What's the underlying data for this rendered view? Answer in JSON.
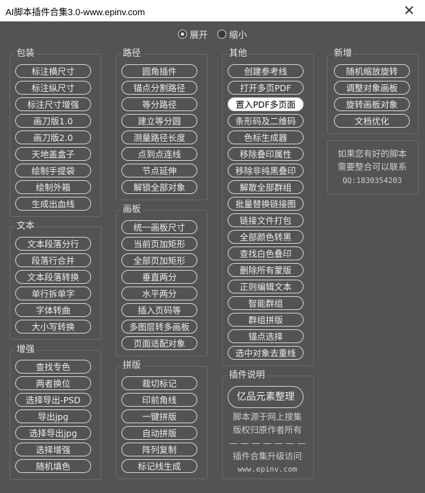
{
  "window": {
    "title": "AI脚本插件合集3.0-www.epinv.com",
    "close": "✕"
  },
  "mode": {
    "expand": "展开",
    "collapse": "缩小"
  },
  "groups": {
    "baozhuang": {
      "label": "包装",
      "items": [
        "标注横尺寸",
        "标注纵尺寸",
        "标注尺寸增强",
        "画刀版1.0",
        "画刀版2.0",
        "天地盖盒子",
        "绘制手提袋",
        "绘制外箱",
        "生成出血线"
      ]
    },
    "wenben": {
      "label": "文本",
      "items": [
        "文本段落分行",
        "段落行合并",
        "文本段落转换",
        "单行拆单字",
        "字体转曲",
        "大小写转换"
      ]
    },
    "zengqiang": {
      "label": "增强",
      "items": [
        "查找专色",
        "两者换位",
        "选择导出-PSD",
        "导出jpg",
        "选择导出jpg",
        "选择增强",
        "随机填色"
      ]
    },
    "lujing": {
      "label": "路径",
      "items": [
        "圆角插件",
        "锚点分割路径",
        "等分路径",
        "建立等分圆",
        "测量路径长度",
        "点到点连线",
        "节点延伸",
        "解锁全部对象"
      ]
    },
    "huaban": {
      "label": "画板",
      "items": [
        "统一画板尺寸",
        "当前页加矩形",
        "全部页加矩形",
        "垂直两分",
        "水平两分",
        "插入页码等",
        "多图层转多画板",
        "页面适配对象"
      ]
    },
    "pinban": {
      "label": "拼版",
      "items": [
        "裁切标记",
        "印前角线",
        "一键拼版",
        "自动拼版",
        "阵列复制",
        "标记线生成"
      ]
    },
    "qita": {
      "label": "其他",
      "items": [
        "创建参考线",
        "打开多页PDF",
        "置入PDF多页面",
        "条形码及二维码",
        "色标生成器",
        "移除叠印属性",
        "移除非纯黑叠印",
        "解散全部群组",
        "批量替换链接图",
        "链接文件打包",
        "全部颜色转黑",
        "查找白色叠印",
        "删除所有蒙版",
        "正则编辑文本",
        "智能群组",
        "群组拼版",
        "锚点选择",
        "选中对象去重线"
      ]
    },
    "xinzeng": {
      "label": "新增",
      "items": [
        "随机缩放旋转",
        "调整对象画板",
        "旋转画板对象",
        "文档优化"
      ]
    },
    "shuoming": {
      "label": "插件说明",
      "button": "亿品元素整理",
      "line1": "脚本源于网上搜集",
      "line2": "版权归原作者所有",
      "divider": "— — — — — — —",
      "line3": "插件合集升级访问",
      "site": "www.epinv.com"
    }
  },
  "contact": {
    "line1": "如果您有好的脚本",
    "line2": "需要整合可以联系",
    "qq": "QQ:1830354203"
  }
}
